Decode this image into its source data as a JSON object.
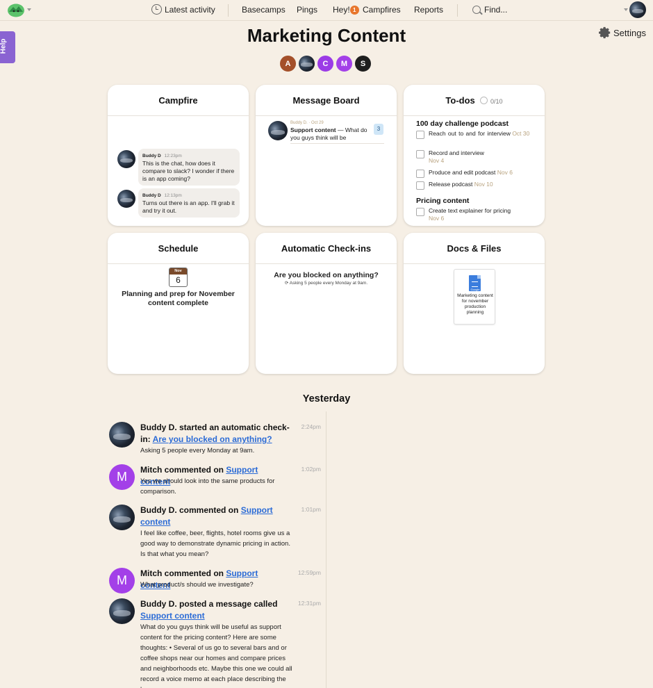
{
  "nav": {
    "latest_activity": "Latest activity",
    "basecamps": "Basecamps",
    "pings": "Pings",
    "hey": "Hey!",
    "hey_count": "1",
    "campfires": "Campfires",
    "reports": "Reports",
    "find": "Find..."
  },
  "help_label": "Help",
  "settings_label": "Settings",
  "page_title": "Marketing Content",
  "people": [
    {
      "initial": "A",
      "color": "#a4502a"
    },
    {
      "initial": "",
      "color": "#2a3344"
    },
    {
      "initial": "C",
      "color": "#9b3be6"
    },
    {
      "initial": "M",
      "color": "#a340e8"
    },
    {
      "initial": "S",
      "color": "#1e1e1e"
    }
  ],
  "campfire": {
    "title": "Campfire",
    "lines": [
      {
        "author": "Buddy D",
        "time": "12:23pm",
        "text": "This is the chat, how does it compare to slack? I wonder if there is an app coming?"
      },
      {
        "author": "Buddy D",
        "time": "12:13pm",
        "text": "Turns out there is an app. I'll grab it and try it out."
      }
    ]
  },
  "message_board": {
    "title": "Message Board",
    "meta": "Buddy D. · Oct 29",
    "subject": "Support content",
    "excerpt": " — What do you guys think will be",
    "count": "3"
  },
  "todos": {
    "title": "To-dos",
    "progress_text": "0/10",
    "progress": 0,
    "lists": [
      {
        "name": "100 day challenge podcast",
        "items": [
          {
            "text": "Reach out to        and         for interview",
            "date": "Oct 30"
          },
          {
            "text": "Record        and          interview",
            "date": "Nov 4"
          },
          {
            "text": "Produce and edit podcast",
            "date": "Nov 6"
          },
          {
            "text": "Release podcast",
            "date": "Nov 10"
          }
        ]
      },
      {
        "name": "Pricing content",
        "items": [
          {
            "text": "Create text explainer for pricing",
            "date": "Nov 6"
          }
        ]
      }
    ]
  },
  "schedule": {
    "title": "Schedule",
    "month": "Nov",
    "day": "6",
    "event": "Planning and prep for November content complete"
  },
  "checkins": {
    "title": "Automatic Check-ins",
    "question": "Are you blocked on anything?",
    "detail": "Asking 5 people every Monday at 9am."
  },
  "docs": {
    "title": "Docs & Files",
    "file_name": "Marketing content for november production planning",
    "file_type_label": "Google"
  },
  "activity": {
    "heading": "Yesterday",
    "items": [
      {
        "actor": "Buddy D. started an automatic check-in: ",
        "link": "Are you blocked on anything?",
        "time": "2:24pm",
        "body": "Asking 5 people every Monday at 9am."
      },
      {
        "actor": "Mitch commented on ",
        "link": "Support content",
        "time": "1:02pm",
        "body": "Yes we should look into the same products for comparison.",
        "initial": "M"
      },
      {
        "actor": "Buddy D. commented on ",
        "link": "Support content",
        "time": "1:01pm",
        "body": "I feel like coffee, beer, flights, hotel rooms give us a good way to demonstrate dynamic pricing in action. Is that what you mean?"
      },
      {
        "actor": "Mitch commented on ",
        "link": "Support content",
        "time": "12:59pm",
        "body": "What product/s should we investigate?",
        "initial": "M"
      },
      {
        "actor": "Buddy D. posted a message called ",
        "link": "Support content",
        "time": "12:31pm",
        "body": "What do you guys think will be useful as support content for the pricing content? Here are some thoughts: • Several of us go to several bars and or coffee shops near our homes and compare prices and neighborhoods etc. Maybe this one we could all record a voice memo at each place describing the bar."
      }
    ]
  },
  "colors": {
    "background": "#f6efe5",
    "link": "#2b6bd6",
    "help_tab": "#8a63d2",
    "badge": "#e8762c"
  }
}
